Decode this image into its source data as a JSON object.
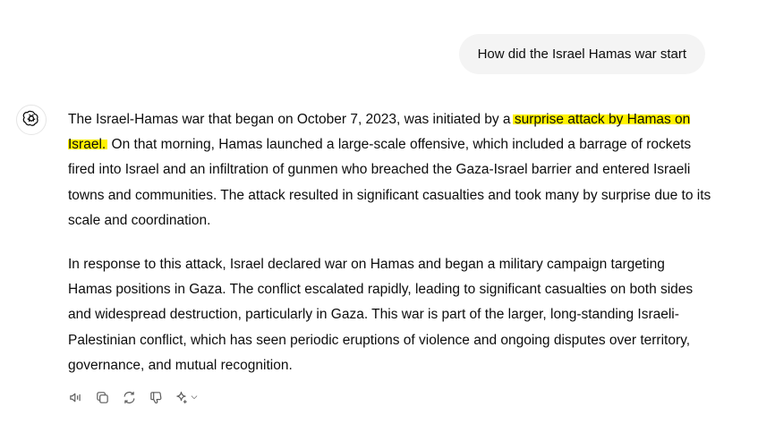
{
  "user_message": "How did the Israel Hamas war start",
  "response": {
    "p1_before": "The Israel-Hamas war that began on October 7, 2023, was initiated by a ",
    "p1_highlight": "surprise attack by Hamas on Israel.",
    "p1_after": " On that morning, Hamas launched a large-scale offensive, which included a barrage of rockets fired into Israel and an infiltration of gunmen who breached the Gaza-Israel barrier and entered Israeli towns and communities. The attack resulted in significant casualties and took many by surprise due to its scale and coordination.",
    "p2": "In response to this attack, Israel declared war on Hamas and began a military campaign targeting Hamas positions in Gaza. The conflict escalated rapidly, leading to significant casualties on both sides and widespread destruction, particularly in Gaza. This war is part of the larger, long-standing Israeli-Palestinian conflict, which has seen periodic eruptions of violence and ongoing disputes over territory, governance, and mutual recognition."
  },
  "colors": {
    "highlight": "#fff200",
    "user_bubble_bg": "#f4f4f4",
    "icon_gray": "#5d5d5d"
  },
  "icons": {
    "assistant_avatar": "openai-logo-icon",
    "actions": [
      "read-aloud-icon",
      "copy-icon",
      "regenerate-icon",
      "thumbs-down-icon",
      "sparkle-model-icon"
    ]
  }
}
